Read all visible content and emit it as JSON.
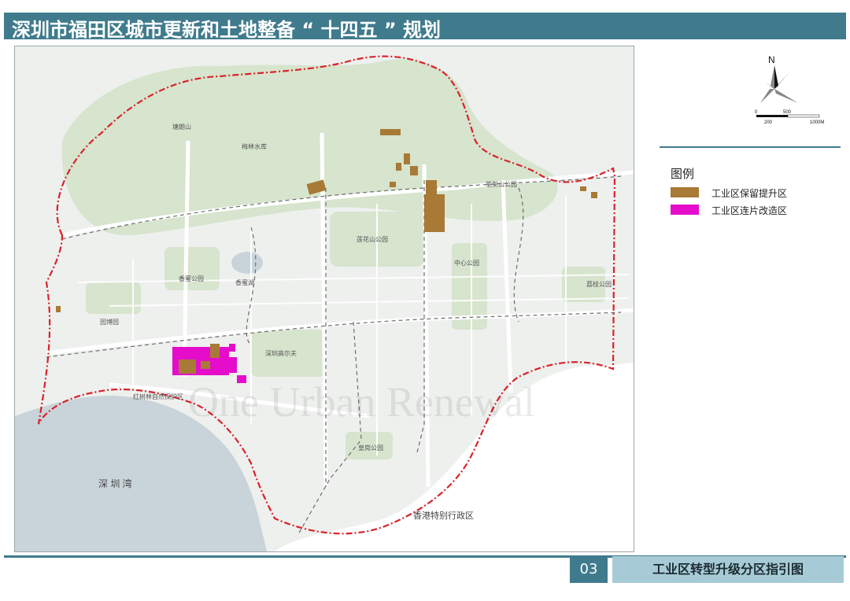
{
  "header": {
    "title": "深圳市福田区城市更新和土地整备 “ 十四五 ” 规划"
  },
  "map": {
    "watermark": "One Urban Renewal",
    "labels": {
      "shenzhen_bay": "深 圳 湾",
      "hong_kong": "香港特别行政区",
      "mountain_1": "塘朗山",
      "park_1": "梅林水库",
      "park_2": "笔架山公园",
      "park_3": "莲花山公园",
      "park_4": "中心公园",
      "park_5": "荔枝公园",
      "park_6": "香蜜公园",
      "lake": "香蜜湖",
      "park_7": "深圳高尔夫",
      "park_8": "园博园",
      "reserve": "红树林自然保护区",
      "park_9": "皇岗公园"
    },
    "colors": {
      "retain_upgrade": "#a87a35",
      "contiguous_renovation": "#e60ccb",
      "boundary": "#d8232a",
      "green": "#d7e4ce",
      "water": "#c9d4da"
    }
  },
  "north_arrow": {
    "letter": "N"
  },
  "scale_bar": {
    "labels": [
      "0",
      "200",
      "500",
      "1000M"
    ]
  },
  "legend": {
    "title": "图例",
    "items": [
      {
        "label": "工业区保留提升区",
        "color": "#a87a35"
      },
      {
        "label": "工业区连片改造区",
        "color": "#e60ccb"
      }
    ]
  },
  "footer": {
    "page_number": "03",
    "caption": "工业区转型升级分区指引图"
  }
}
